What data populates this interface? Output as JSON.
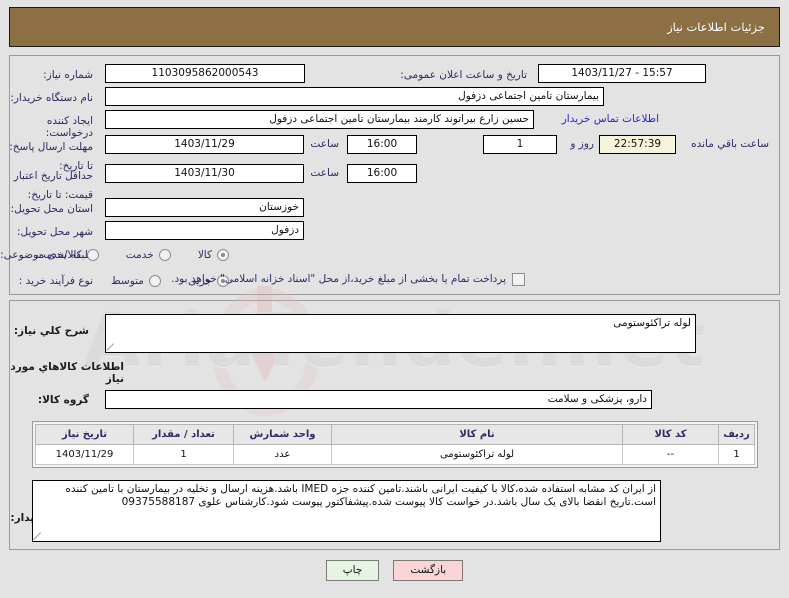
{
  "header": {
    "title": "جزئیات اطلاعات نیاز"
  },
  "form": {
    "need_number": {
      "label": "شماره نیاز:",
      "value": "1103095862000543"
    },
    "announce": {
      "label": "تاریخ و ساعت اعلان عمومی:",
      "value": "15:57 - 1403/11/27"
    },
    "buyer_org": {
      "label": "نام دستگاه خریدار:",
      "value": "بیمارستان تامین اجتماعی دزفول"
    },
    "creator": {
      "label": "ایجاد کننده درخواست:",
      "value": "حسین زارع بیراتوند کارمند بیمارستان تامین اجتماعی دزفول"
    },
    "contact_link": "اطلاعات تماس خریدار",
    "reply_deadline": {
      "label": "مهلت ارسال پاسخ: تا تاریخ:",
      "date": "1403/11/29",
      "hour_label": "ساعت",
      "hour": "16:00",
      "days": "1",
      "days_label": "روز و",
      "remaining": "22:57:39",
      "remaining_label": "ساعت باقي مانده"
    },
    "price_validity": {
      "label": "حداقل تاریخ اعتبار قیمت: تا تاریخ:",
      "date": "1403/11/30",
      "hour_label": "ساعت",
      "hour": "16:00"
    },
    "province": {
      "label": "استان محل تحویل:",
      "value": "خوزستان"
    },
    "city": {
      "label": "شهر محل تحویل:",
      "value": "دزفول"
    },
    "category": {
      "label": "طبقه بندی موضوعی:",
      "options": [
        "کالا",
        "خدمت",
        "کالا/خدمت"
      ],
      "selected": "کالا"
    },
    "process_type": {
      "label": "نوع فرآیند خرید :",
      "options": [
        "جزیی",
        "متوسط"
      ],
      "selected": "جزیی",
      "treasury_checkbox_label": "پرداخت تمام یا بخشی از مبلغ خرید،از محل \"اسناد خزانه اسلامی\" خواهد بود.",
      "treasury_checked": false
    }
  },
  "summary": {
    "label": "شرح کلي نیاز:",
    "value": "لوله تراکئوستومی"
  },
  "goods_section": {
    "heading": "اطلاعات کالاهاي مورد نیاز",
    "group_label": "گروه کالا:",
    "group_value": "دارو، پزشکی و سلامت",
    "columns": [
      "ردیف",
      "کد کالا",
      "نام کالا",
      "واحد شمارش",
      "تعداد / مقدار",
      "تاریخ نیاز"
    ],
    "rows": [
      {
        "index": "1",
        "code": "--",
        "name": "لوله تراکئوستومی",
        "unit": "عدد",
        "quantity": "1",
        "need_date": "1403/11/29"
      }
    ]
  },
  "notes": {
    "label": "توضیحات خریدار:",
    "value": "از ایران کد مشابه استفاده شده،کالا با کیفیت ایرانی باشند.تامین کننده جزه IMED باشد.هزینه ارسال و تخلیه در بیمارستان با تامین کننده است.تاریخ انقضا بالای یک سال باشد.در خواست کالا پیوست شده.پیشفاکتور پیوست شود.کارشناس علوی 09375588187"
  },
  "buttons": {
    "back": "بازگشت",
    "print": "چاپ"
  },
  "watermark": {
    "text": "AriaTender.net"
  },
  "colors": {
    "header_bg": "#8c6f42",
    "page_bg": "#e3e3e3",
    "label": "#2b2b66",
    "link": "#2626c9",
    "back_btn": "#fbd5d5",
    "print_btn": "#e6f5e1",
    "timer_bg": "#f7f4dc"
  }
}
